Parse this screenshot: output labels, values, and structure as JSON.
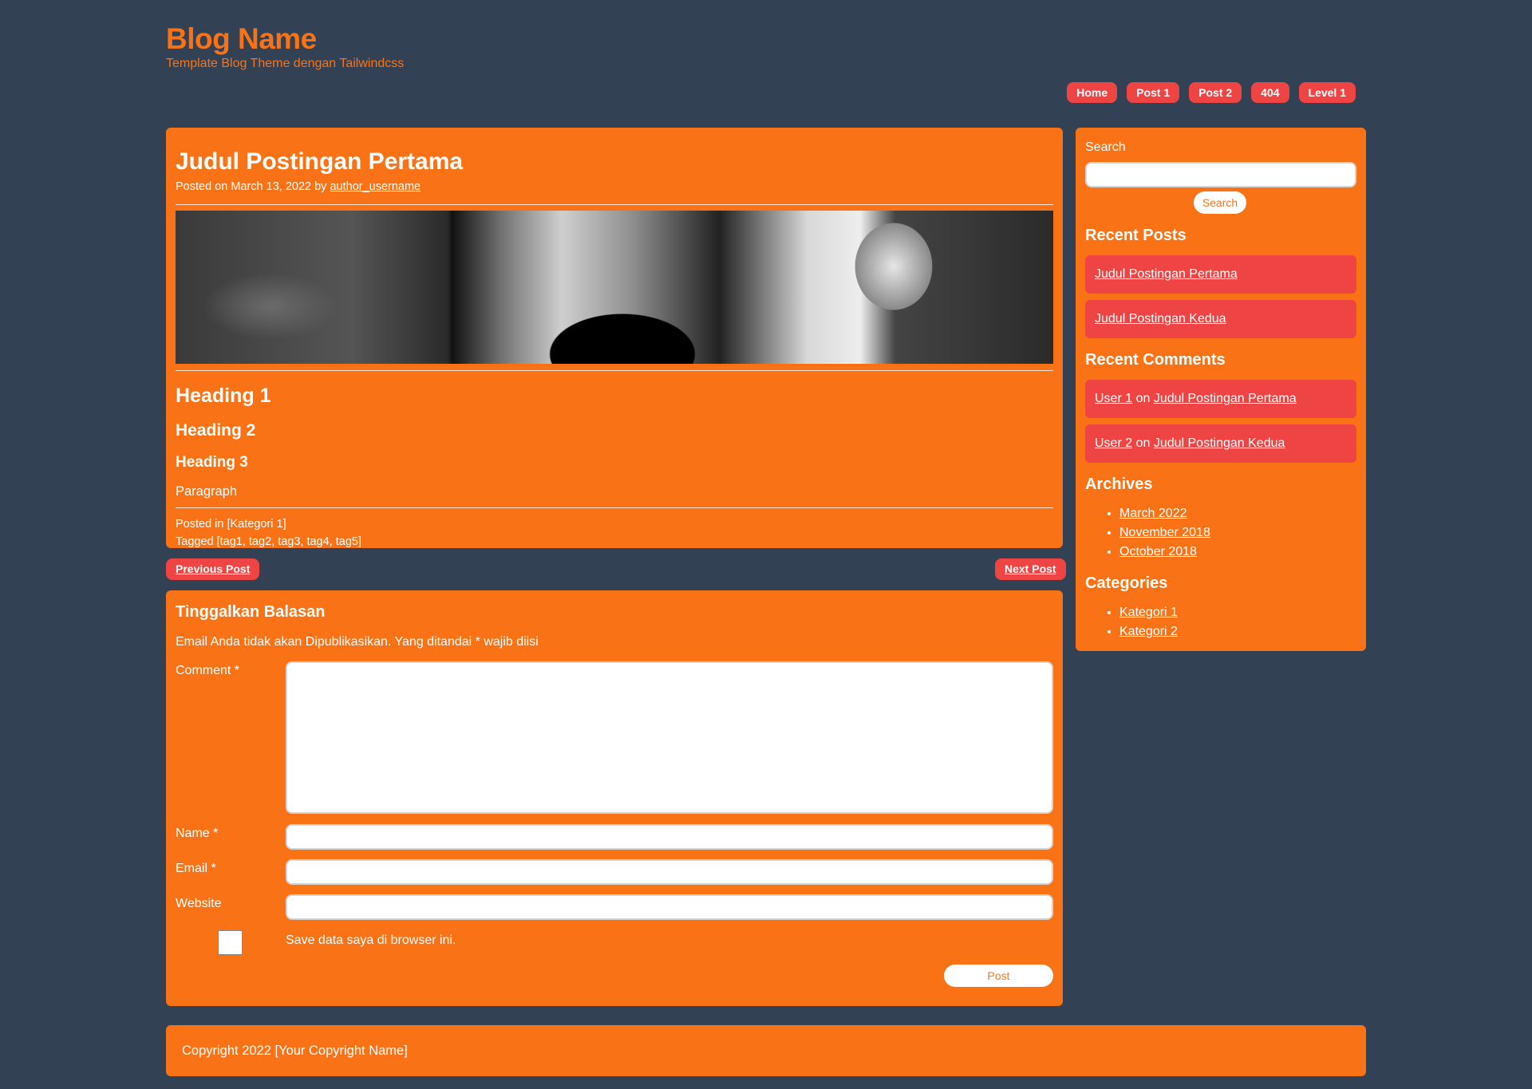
{
  "header": {
    "title": "Blog Name",
    "tagline": "Template Blog Theme dengan Tailwindcss"
  },
  "nav": [
    "Home",
    "Post 1",
    "Post 2",
    "404",
    "Level 1"
  ],
  "article": {
    "title": "Judul Postingan Pertama",
    "meta_prefix": "Posted on March 13, 2022 by ",
    "author": "author_username",
    "heading1": "Heading 1",
    "heading2": "Heading 2",
    "heading3": "Heading 3",
    "paragraph": "Paragraph",
    "posted_in": "Posted in [Kategori 1]",
    "tagged": "Tagged [tag1, tag2, tag3, tag4, tag5]"
  },
  "pager": {
    "previous": "Previous Post",
    "next": "Next Post"
  },
  "comment_form": {
    "title": "Tinggalkan Balasan",
    "note": "Email Anda tidak akan Dipublikasikan. Yang ditandai * wajib diisi",
    "comment_label": "Comment *",
    "comment_value": "",
    "name_label": "Name *",
    "name_value": "",
    "email_label": "Email *",
    "email_value": "",
    "website_label": "Website",
    "website_value": "",
    "save_label": "Save data saya di browser ini.",
    "submit_label": "Post"
  },
  "sidebar": {
    "search_label": "Search",
    "search_value": "",
    "search_button": "Search",
    "recent_posts_title": "Recent Posts",
    "recent_posts": [
      "Judul Postingan Pertama",
      "Judul Postingan Kedua"
    ],
    "recent_comments_title": "Recent Comments",
    "recent_comments": [
      {
        "user": "User 1",
        "on": " on ",
        "post": "Judul Postingan Pertama"
      },
      {
        "user": "User 2",
        "on": " on ",
        "post": "Judul Postingan Kedua"
      }
    ],
    "archives_title": "Archives",
    "archives": [
      "March 2022",
      "November 2018",
      "October 2018"
    ],
    "categories_title": "Categories",
    "categories": [
      "Kategori 1",
      "Kategori 2"
    ]
  },
  "footer": {
    "copyright": "Copyright 2022 [Your Copyright Name]"
  },
  "colors": {
    "background": "#334155",
    "accent": "#f97316",
    "button": "#ef4444"
  }
}
